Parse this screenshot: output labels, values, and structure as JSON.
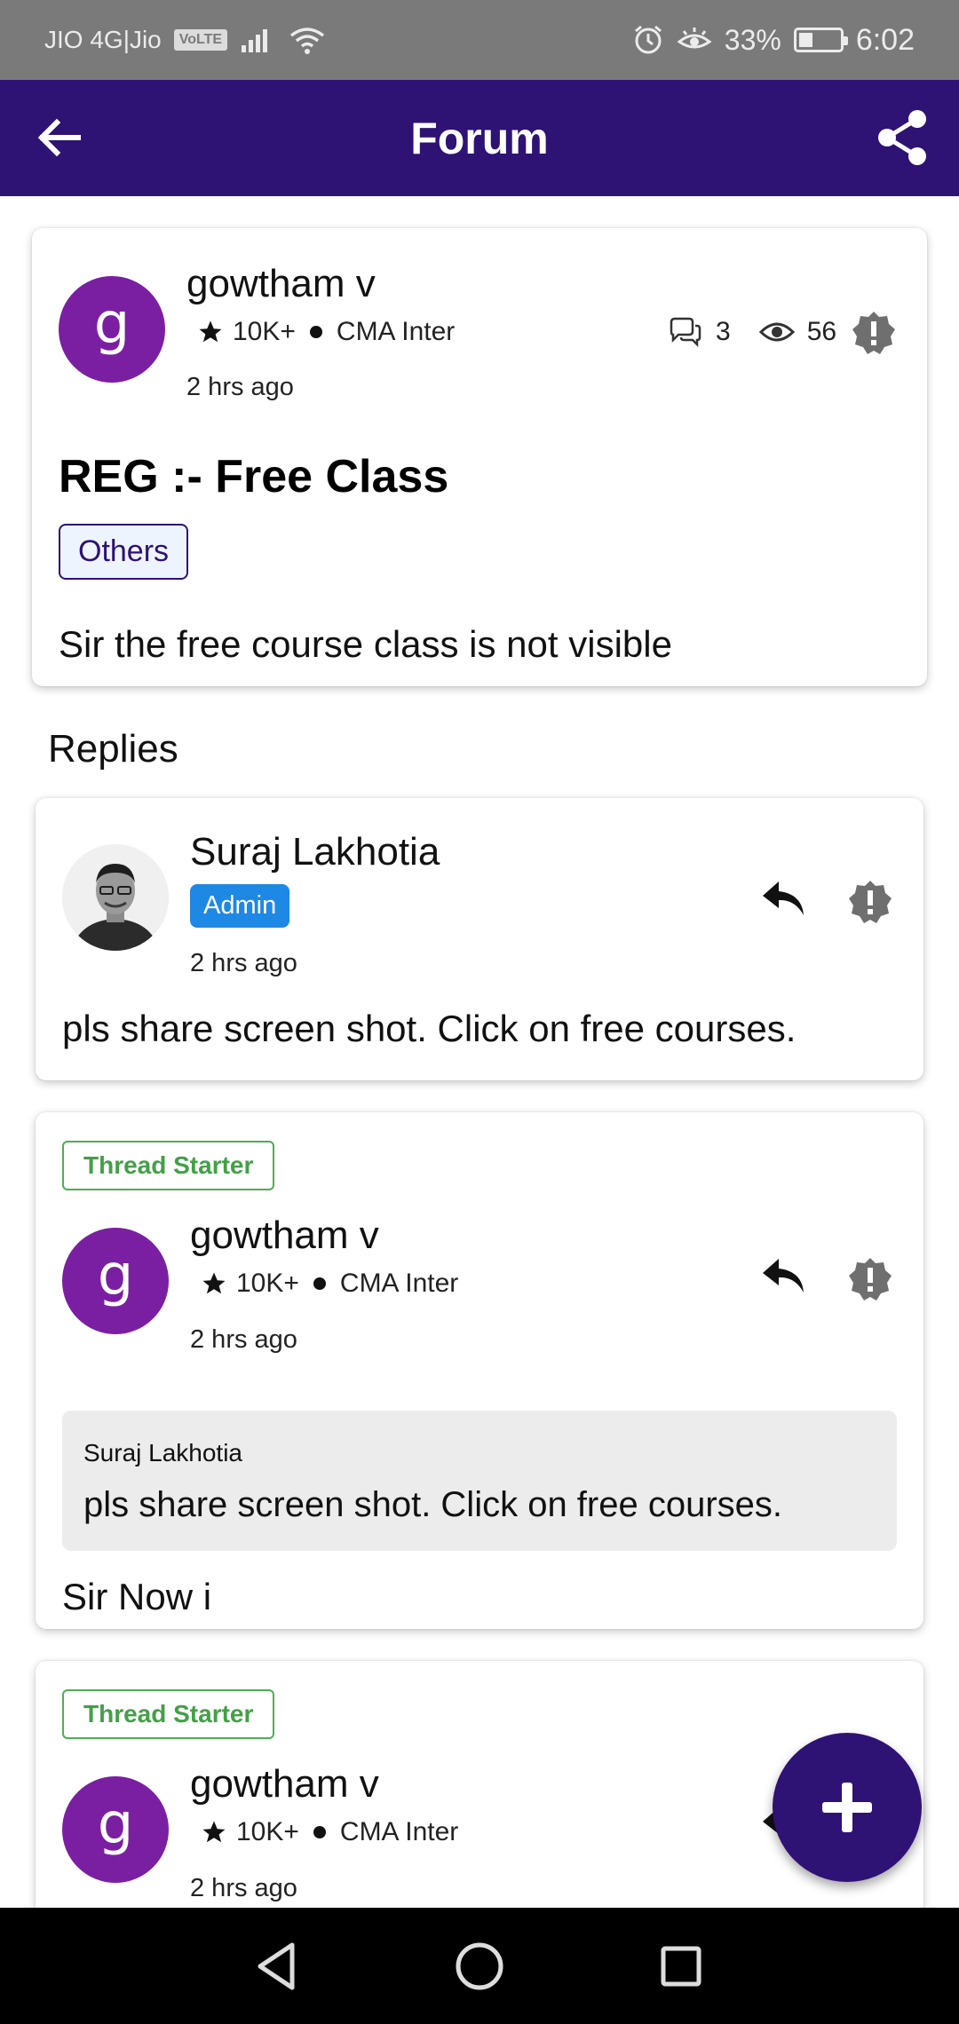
{
  "status_bar": {
    "carrier": "JIO 4G|Jio",
    "volte": "VoLTE",
    "battery": "33%",
    "battery_level": 0.33,
    "time": "6:02"
  },
  "app_bar": {
    "title": "Forum",
    "back_icon": "arrow-left-icon",
    "share_icon": "share-icon"
  },
  "post": {
    "avatar_letter": "g",
    "author": "gowtham v",
    "points": "10K+",
    "course": "CMA Inter",
    "time_ago": "2 hrs ago",
    "replies_count": "3",
    "views_count": "56",
    "title": "REG :- Free Class",
    "tag": "Others",
    "body": "Sir the free course class is not visible"
  },
  "replies_heading": "Replies",
  "replies": [
    {
      "author": "Suraj Lakhotia",
      "badge": "Admin",
      "time_ago": "2 hrs ago",
      "body": "pls share screen shot. Click on free courses."
    },
    {
      "badge": "Thread Starter",
      "avatar_letter": "g",
      "author": "gowtham v",
      "points": "10K+",
      "course": "CMA Inter",
      "time_ago": "2 hrs ago",
      "quote_author": "Suraj Lakhotia",
      "quote_text": "pls share screen shot. Click on free courses.",
      "body": "Sir Now i"
    },
    {
      "badge": "Thread Starter",
      "avatar_letter": "g",
      "author": "gowtham v",
      "points": "10K+",
      "course": "CMA Inter",
      "time_ago": "2 hrs ago"
    }
  ],
  "fab_icon": "plus-icon",
  "colors": {
    "primary": "#2e1274",
    "avatar": "#7b1fa2",
    "admin_badge": "#1e88e5",
    "thread_starter": "#43a047"
  }
}
